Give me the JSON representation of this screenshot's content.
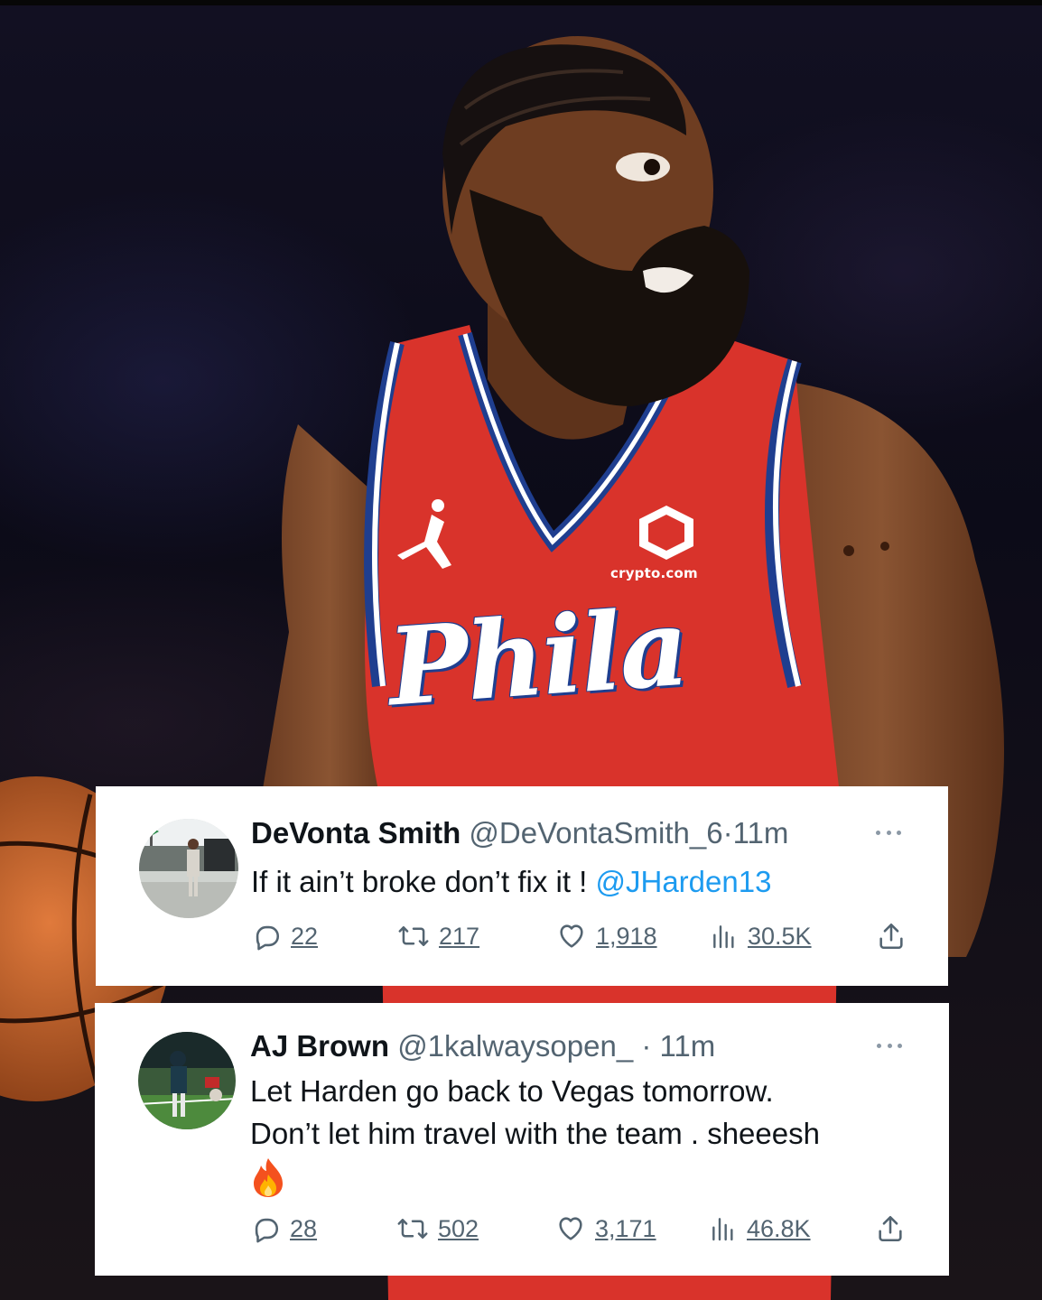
{
  "graphic": {
    "jersey_wordmark": "Phila",
    "jersey_sponsor": "crypto.com"
  },
  "colors": {
    "jersey_red": "#d9332b",
    "jersey_blue": "#1f3e8f",
    "link_blue": "#1d9bf0",
    "secondary_text": "#536471"
  },
  "tweets": [
    {
      "display_name": "DeVonta Smith",
      "handle": "@DeVontaSmith_6",
      "separator": "·",
      "time": "11m",
      "text": "If it ain’t broke don’t fix it ! ",
      "mention": "@JHarden13",
      "line2": "",
      "emoji": "",
      "replies": "22",
      "reposts": "217",
      "likes": "1,918",
      "views": "30.5K",
      "icons": [
        "reply-icon",
        "repost-icon",
        "like-icon",
        "views-icon",
        "share-icon",
        "more-icon"
      ]
    },
    {
      "display_name": "AJ Brown",
      "handle": "@1kalwaysopen_",
      "separator": "·",
      "time": "11m",
      "text": "Let Harden go back to Vegas tomorrow.",
      "mention": "",
      "line2": "Don’t let him travel with the team . sheeesh",
      "emoji": "fire-emoji",
      "replies": "28",
      "reposts": "502",
      "likes": "3,171",
      "views": "46.8K",
      "icons": [
        "reply-icon",
        "repost-icon",
        "like-icon",
        "views-icon",
        "share-icon",
        "more-icon"
      ]
    }
  ]
}
